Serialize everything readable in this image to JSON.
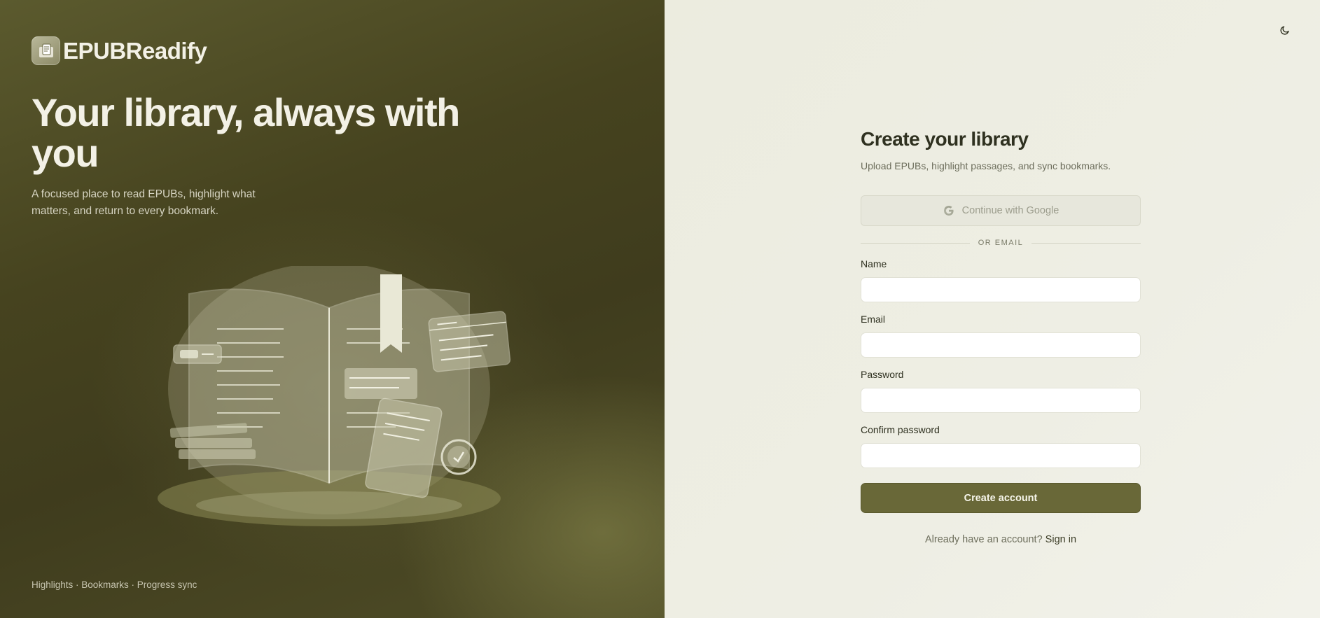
{
  "brand": {
    "name": "EPUBReadify",
    "logo_icon": "book-logo-icon"
  },
  "hero": {
    "title": "Your library, always with you",
    "subtitle": "A focused place to read EPUBs, highlight what matters, and return to every bookmark.",
    "footer": "Highlights · Bookmarks · Progress sync"
  },
  "header": {
    "theme_toggle_icon": "moon-icon"
  },
  "form": {
    "title": "Create your library",
    "subtitle": "Upload EPUBs, highlight passages, and sync bookmarks.",
    "google_button": "Continue with Google",
    "divider": "OR EMAIL",
    "fields": [
      {
        "label": "Name",
        "value": "",
        "placeholder": ""
      },
      {
        "label": "Email",
        "value": "",
        "placeholder": ""
      },
      {
        "label": "Password",
        "value": "",
        "placeholder": ""
      },
      {
        "label": "Confirm password",
        "value": "",
        "placeholder": ""
      }
    ],
    "submit_label": "Create account",
    "signin_prompt": "Already have an account?",
    "signin_link": "Sign in"
  },
  "colors": {
    "hero_bg": "#46431f",
    "panel_bg": "#eeeee4",
    "accent": "#696838",
    "heading": "#2f3120"
  }
}
